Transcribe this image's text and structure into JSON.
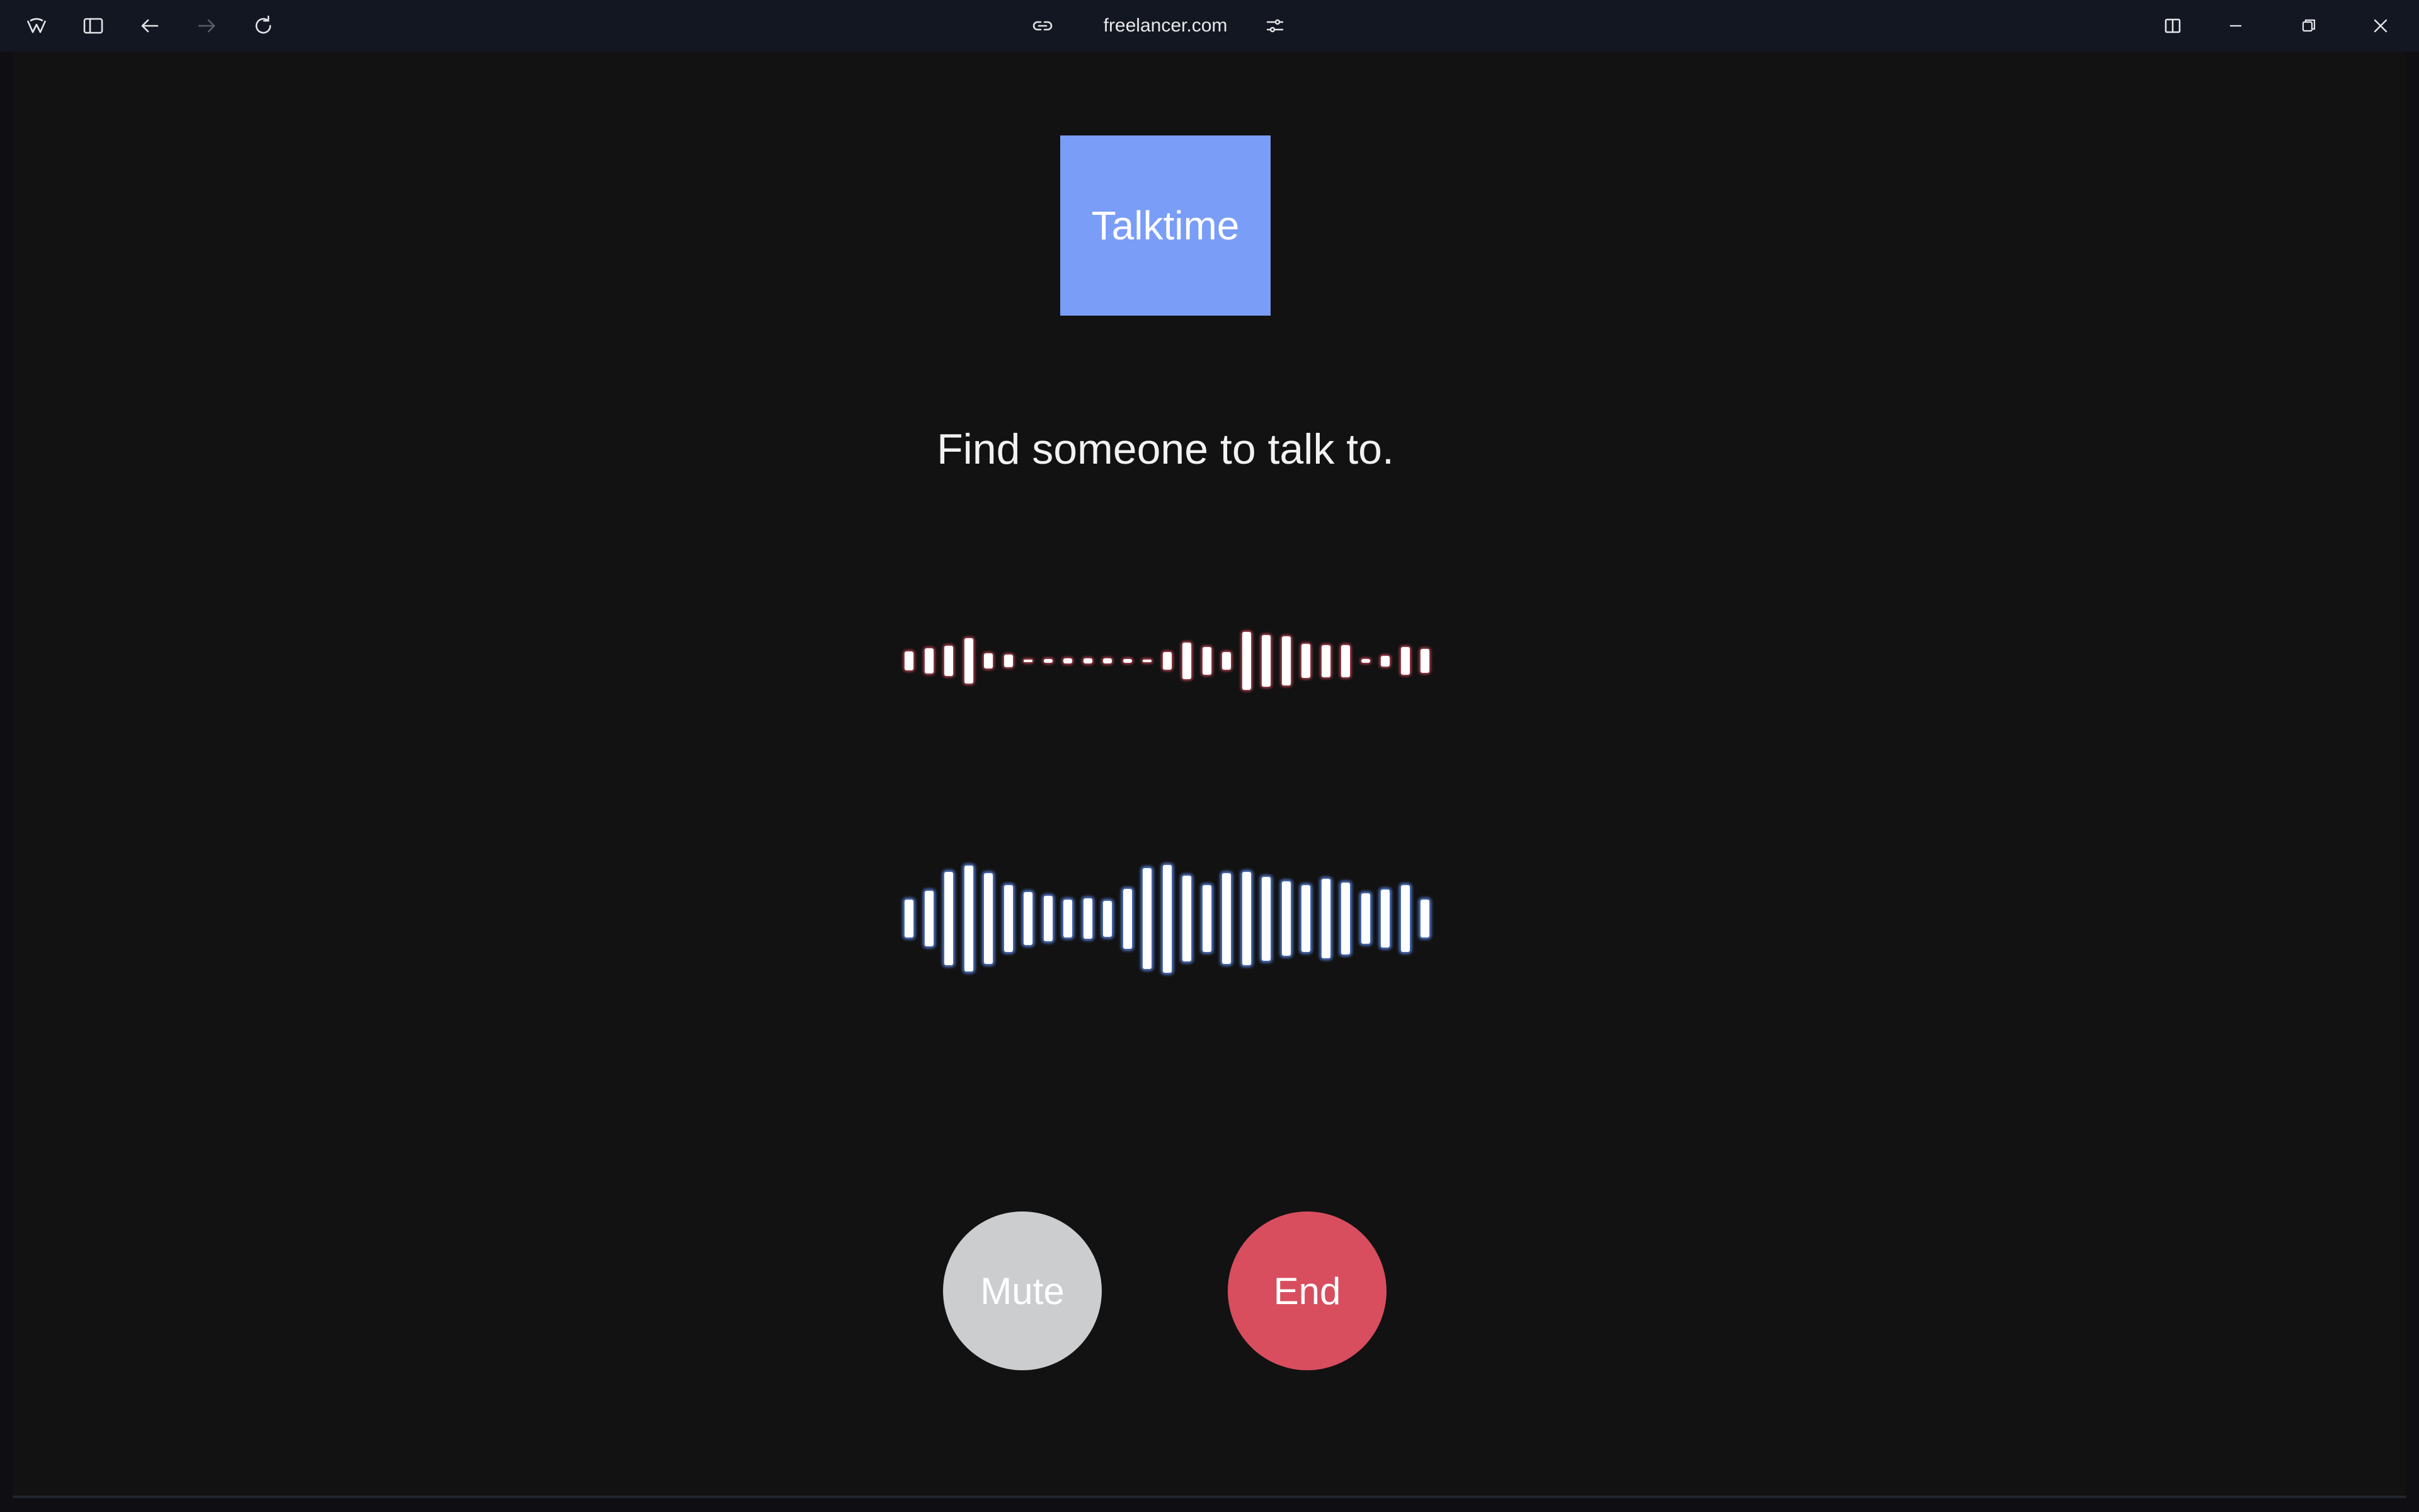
{
  "browser": {
    "address": "freelancer.com",
    "icons": {
      "app": "app-logo-icon",
      "sidebar": "sidebar-toggle-icon",
      "back": "back-arrow-icon",
      "forward": "forward-arrow-icon",
      "reload": "reload-icon",
      "link": "link-icon",
      "settings": "site-settings-icon",
      "split": "split-view-icon",
      "minimize": "minimize-icon",
      "restore": "restore-icon",
      "close": "close-icon"
    }
  },
  "app": {
    "logo_text": "Talktime",
    "tagline": "Find someone to talk to.",
    "mute_label": "Mute",
    "end_label": "End"
  },
  "waveforms": {
    "remote": {
      "color": "#ff5a6e",
      "levels": [
        0.18,
        0.24,
        0.28,
        0.42,
        0.14,
        0.12,
        0.02,
        0.04,
        0.05,
        0.05,
        0.05,
        0.04,
        0.02,
        0.16,
        0.34,
        0.26,
        0.16,
        0.54,
        0.48,
        0.46,
        0.32,
        0.3,
        0.3,
        0.04,
        0.1,
        0.26,
        0.22
      ]
    },
    "local": {
      "color": "#6496ff",
      "levels": [
        0.32,
        0.46,
        0.78,
        0.88,
        0.76,
        0.56,
        0.44,
        0.38,
        0.32,
        0.34,
        0.3,
        0.5,
        0.84,
        0.9,
        0.72,
        0.56,
        0.76,
        0.78,
        0.7,
        0.62,
        0.56,
        0.66,
        0.6,
        0.42,
        0.48,
        0.56,
        0.32
      ]
    }
  }
}
